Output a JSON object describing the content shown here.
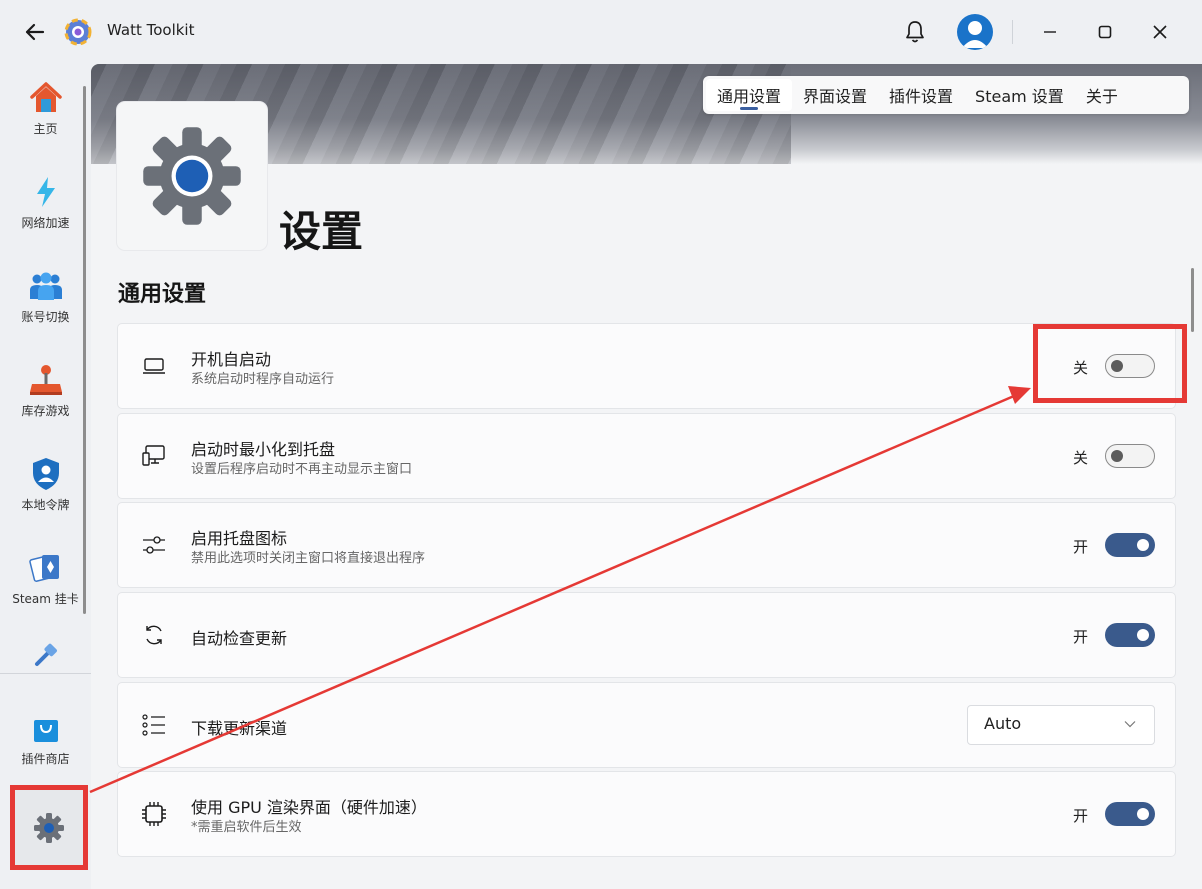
{
  "app": {
    "title": "Watt Toolkit"
  },
  "sidebar": {
    "items": [
      {
        "label": "主页",
        "icon": "home-icon"
      },
      {
        "label": "网络加速",
        "icon": "lightning-icon"
      },
      {
        "label": "账号切换",
        "icon": "users-icon"
      },
      {
        "label": "库存游戏",
        "icon": "joystick-icon"
      },
      {
        "label": "本地令牌",
        "icon": "shield-user-icon"
      },
      {
        "label": "Steam 挂卡",
        "icon": "cards-icon"
      },
      {
        "label": "",
        "icon": "tool-icon"
      }
    ],
    "plugin_store": {
      "label": "插件商店",
      "icon": "shopping-bag-icon"
    },
    "settings": {
      "icon": "settings-gear-icon"
    }
  },
  "tabs": [
    {
      "label": "通用设置",
      "active": true
    },
    {
      "label": "界面设置",
      "active": false
    },
    {
      "label": "插件设置",
      "active": false
    },
    {
      "label": "Steam 设置",
      "active": false
    },
    {
      "label": "关于",
      "active": false
    }
  ],
  "page": {
    "title": "设置",
    "section_title": "通用设置"
  },
  "settings": [
    {
      "title": "开机自启动",
      "desc": "系统启动时程序自动运行",
      "state_label": "关",
      "on": false,
      "icon": "laptop-icon"
    },
    {
      "title": "启动时最小化到托盘",
      "desc": "设置后程序启动时不再主动显示主窗口",
      "state_label": "关",
      "on": false,
      "icon": "devices-icon"
    },
    {
      "title": "启用托盘图标",
      "desc": "禁用此选项时关闭主窗口将直接退出程序",
      "state_label": "开",
      "on": true,
      "icon": "slider-icon"
    },
    {
      "title": "自动检查更新",
      "desc": "",
      "state_label": "开",
      "on": true,
      "icon": "refresh-icon"
    },
    {
      "title": "下载更新渠道",
      "desc": "",
      "select_value": "Auto",
      "icon": "list-icon"
    },
    {
      "title": "使用 GPU 渲染界面（硬件加速）",
      "desc": "*需重启软件后生效",
      "state_label": "开",
      "on": true,
      "icon": "chip-icon"
    }
  ],
  "colors": {
    "accent": "#3a5a8c",
    "annotation_red": "#e53935",
    "avatar_blue": "#1a73c9"
  }
}
